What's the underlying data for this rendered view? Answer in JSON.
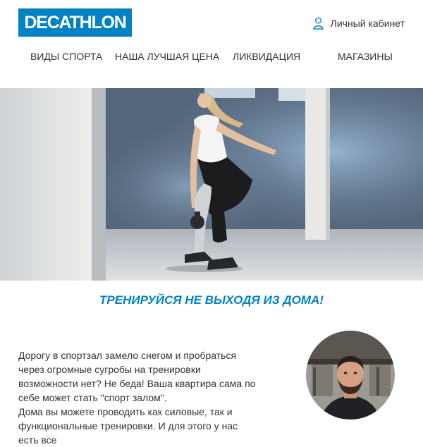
{
  "header": {
    "logo_text": "DECATHLON",
    "account_label": "Личный кабинет",
    "brand_color": "#0082c3"
  },
  "nav": {
    "items": [
      {
        "label": "ВИДЫ СПОРТА"
      },
      {
        "label": "НАША ЛУЧШАЯ ЦЕНА"
      },
      {
        "label": "ЛИКВИДАЦИЯ"
      },
      {
        "label": "МАГАЗИНЫ"
      }
    ]
  },
  "hero": {
    "image": "woman-kettlebell-workout-photo"
  },
  "content": {
    "headline": "ТРЕНИРУЙСЯ НЕ ВЫХОДЯ ИЗ ДОМА!",
    "paragraph_1": "Дорогу в спортзал замело снегом и пробраться через огромные сугробы на тренировки возможности нет? Не беда! Ваша квартира сама по себе может стать \"спорт залом\".",
    "paragraph_2": "Дома вы можете проводить как силовые, так и функциональные тренировки. И для этого у нас есть все"
  },
  "author": {
    "image": "coach-portrait-photo"
  }
}
